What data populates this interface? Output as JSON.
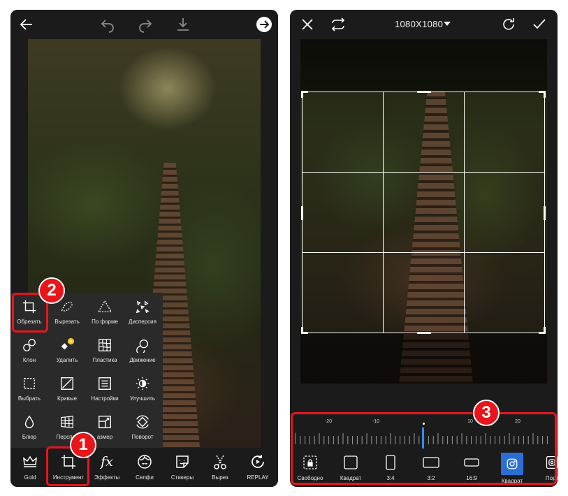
{
  "colors": {
    "accent_red": "#e8151b",
    "app_bg": "#1b1b1c",
    "panel_bg": "#2a2a2b",
    "selected_blue": "#2a6fd6",
    "ruler_marker": "#2d8ff0"
  },
  "left": {
    "topbar_icons": [
      "back-arrow-icon",
      "undo-icon",
      "redo-icon",
      "download-icon",
      "next-arrow-icon"
    ],
    "tools": [
      {
        "label": "Обрезать",
        "icon": "crop-icon"
      },
      {
        "label": "Вырезать",
        "icon": "cutout-icon"
      },
      {
        "label": "По форме",
        "icon": "shape-crop-icon"
      },
      {
        "label": "Дисперсия",
        "icon": "dispersion-icon"
      },
      {
        "label": "Клон",
        "icon": "clone-icon"
      },
      {
        "label": "Удалить",
        "icon": "remove-icon"
      },
      {
        "label": "Пластика",
        "icon": "stretch-icon"
      },
      {
        "label": "Движение",
        "icon": "motion-icon"
      },
      {
        "label": "Выбрать",
        "icon": "select-icon"
      },
      {
        "label": "Кривые",
        "icon": "curves-icon"
      },
      {
        "label": "Настройки",
        "icon": "adjust-icon"
      },
      {
        "label": "Улучшить",
        "icon": "enhance-icon"
      },
      {
        "label": "Блюр",
        "icon": "blur-icon"
      },
      {
        "label": "Перспек",
        "icon": "perspective-icon"
      },
      {
        "label": "азмер",
        "icon": "resize-icon"
      },
      {
        "label": "Поворот",
        "icon": "rotate-icon"
      }
    ],
    "nav": [
      {
        "label": "Gold",
        "icon": "crown-icon"
      },
      {
        "label": "Инструмент",
        "icon": "crop-tool-icon"
      },
      {
        "label": "Эффекты",
        "icon": "fx-icon",
        "glyph": "fx"
      },
      {
        "label": "Селфи",
        "icon": "selfie-icon"
      },
      {
        "label": "Стикеры",
        "icon": "sticker-icon"
      },
      {
        "label": "Вырез",
        "icon": "scissors-icon"
      },
      {
        "label": "REPLAY",
        "icon": "replay-icon"
      }
    ],
    "badges": {
      "one": "1",
      "two": "2"
    }
  },
  "right": {
    "size_label": "1080X1080",
    "topbar_icons": [
      "close-icon",
      "swap-icon",
      "reset-icon",
      "check-icon"
    ],
    "ruler_labels": [
      "-20",
      "-10",
      "10",
      "20"
    ],
    "ratios": [
      {
        "label": "Свободно",
        "icon": "free-lock-icon"
      },
      {
        "label": "Квадрат",
        "icon": "square-icon"
      },
      {
        "label": "3:4",
        "icon": "ratio-3-4-icon"
      },
      {
        "label": "3:2",
        "icon": "ratio-3-2-icon"
      },
      {
        "label": "16:9",
        "icon": "ratio-16-9-icon"
      },
      {
        "label": "Квадрат",
        "icon": "instagram-square-icon",
        "selected": true
      },
      {
        "label": "Порт",
        "icon": "instagram-portrait-icon"
      }
    ],
    "badge": "3"
  }
}
